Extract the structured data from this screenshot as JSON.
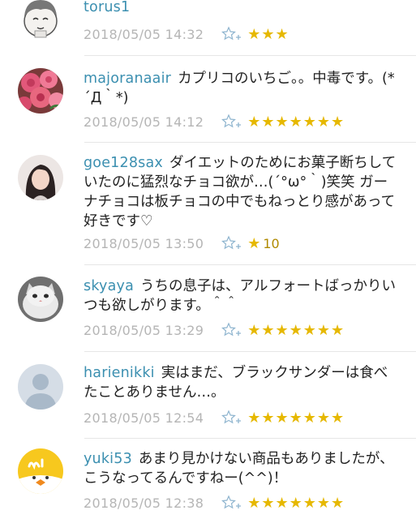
{
  "colors": {
    "username": "#3b8fb0",
    "timestamp": "#b5b5b5",
    "star": "#e6b800",
    "divider": "#e6e6e6"
  },
  "comments": [
    {
      "user": "torus1",
      "text": "",
      "time": "2018/05/05 14:32",
      "stars": "★★★",
      "star_count": "",
      "avatar": "cartoon-face-avatar"
    },
    {
      "user": "majoranaair",
      "text": "カプリコのいちご。。中毒です。(*´Д｀*)",
      "time": "2018/05/05 14:12",
      "stars": "★★★★★★★",
      "star_count": "",
      "avatar": "roses-avatar"
    },
    {
      "user": "goe128sax",
      "text": "ダイエットのためにお菓子断ちしていたのに猛烈なチョコ欲が…(´°ω°｀)笑笑 ガーナチョコは板チョコの中でもねっとり感があって好きです♡",
      "time": "2018/05/05 13:50",
      "stars": "★",
      "star_count": "10",
      "avatar": "woman-photo-avatar"
    },
    {
      "user": "skyaya",
      "text": "うちの息子は、アルフォートばっかりいつも欲しがります。＾＾",
      "time": "2018/05/05 13:29",
      "stars": "★★★★★★★",
      "star_count": "",
      "avatar": "cat-photo-avatar"
    },
    {
      "user": "harienikki",
      "text": "実はまだ、ブラックサンダーは食べたことありません…。",
      "time": "2018/05/05 12:54",
      "stars": "★★★★★★★",
      "star_count": "",
      "avatar": "default-user-avatar"
    },
    {
      "user": "yuki53",
      "text": "あまり見かけない商品もありましたが、こうなってるんですねー(^^)！",
      "time": "2018/05/05 12:38",
      "stars": "★★★★★★★",
      "star_count": "",
      "avatar": "mi-chick-avatar"
    }
  ]
}
